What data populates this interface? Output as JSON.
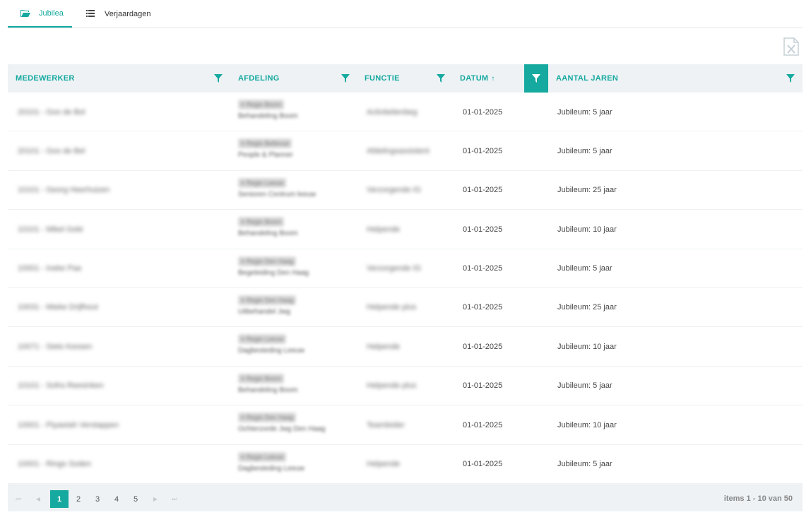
{
  "tabs": [
    {
      "label": "Jubilea",
      "icon": "folder-open-icon",
      "active": true
    },
    {
      "label": "Verjaardagen",
      "icon": "list-icon",
      "active": false
    }
  ],
  "export": {
    "icon": "excel-export-icon"
  },
  "grid": {
    "columns": [
      {
        "label": "MEDEWERKER"
      },
      {
        "label": "AFDELING"
      },
      {
        "label": "FUNCTIE"
      },
      {
        "label": "DATUM",
        "sort": "↑"
      },
      {
        "label": "AANTAL JAREN"
      }
    ],
    "rows": [
      {
        "medewerker": "20101 - Goo de Bol",
        "afdeling_tag": "≡ Regio Boom",
        "afdeling": "Behandeling Boom",
        "functie": "Activiteitenbeg",
        "datum": "01-01-2025",
        "jaren": "Jubileum: 5 jaar"
      },
      {
        "medewerker": "20101 - Goo de Bel",
        "afdeling_tag": "≡ Regio Bellevue",
        "afdeling": "People & Planner",
        "functie": "Afdelingsassistent",
        "datum": "01-01-2025",
        "jaren": "Jubileum: 5 jaar"
      },
      {
        "medewerker": "10101 - Georg Heerhuizen",
        "afdeling_tag": "≡ Regio Leeuw",
        "afdeling": "Senioren Centrum leeuw",
        "functie": "Verzorgende IG",
        "datum": "01-01-2025",
        "jaren": "Jubileum: 25 jaar"
      },
      {
        "medewerker": "10101 - Mikel Gobi",
        "afdeling_tag": "≡ Regio Boom",
        "afdeling": "Behandeling Boom",
        "functie": "Helpende",
        "datum": "01-01-2025",
        "jaren": "Jubileum: 10 jaar"
      },
      {
        "medewerker": "10001 - Ineke Paa",
        "afdeling_tag": "≡ Regio Den Haag",
        "afdeling": "Begeleiding Den Haag",
        "functie": "Verzorgende IG",
        "datum": "01-01-2025",
        "jaren": "Jubileum: 5 jaar"
      },
      {
        "medewerker": "10031 - Mieke Drijfhout",
        "afdeling_tag": "≡ Regio Den Haag",
        "afdeling": "Uitbehandel Jwg",
        "functie": "Helpende plus",
        "datum": "01-01-2025",
        "jaren": "Jubileum: 25 jaar"
      },
      {
        "medewerker": "10071 - Sieto Kessen",
        "afdeling_tag": "≡ Regio Leeuw",
        "afdeling": "Dagbesteding Leeuw",
        "functie": "Helpende",
        "datum": "01-01-2025",
        "jaren": "Jubileum: 10 jaar"
      },
      {
        "medewerker": "10101 - Sofra Reesinken",
        "afdeling_tag": "≡ Regio Boom",
        "afdeling": "Behandeling Boom",
        "functie": "Helpende plus",
        "datum": "01-01-2025",
        "jaren": "Jubileum: 5 jaar"
      },
      {
        "medewerker": "10001 - Piyawiah Verstappen",
        "afdeling_tag": "≡ Regio Den Haag",
        "afdeling": "Ochterzorde Jwg Den Haag",
        "functie": "Teamleider",
        "datum": "01-01-2025",
        "jaren": "Jubileum: 10 jaar"
      },
      {
        "medewerker": "10001 - Ringo Soden",
        "afdeling_tag": "≡ Regio Leeuw",
        "afdeling": "Dagbesteding Leeuw",
        "functie": "Helpende",
        "datum": "01-01-2025",
        "jaren": "Jubileum: 5 jaar"
      }
    ]
  },
  "pager": {
    "first": "⏮",
    "prev": "◀",
    "next": "▶",
    "last": "⏭",
    "pages": [
      "1",
      "2",
      "3",
      "4",
      "5"
    ],
    "current": "1",
    "info": "items 1 - 10 van 50"
  },
  "colors": {
    "accent": "#15a99f",
    "header_bg": "#eef2f5"
  }
}
